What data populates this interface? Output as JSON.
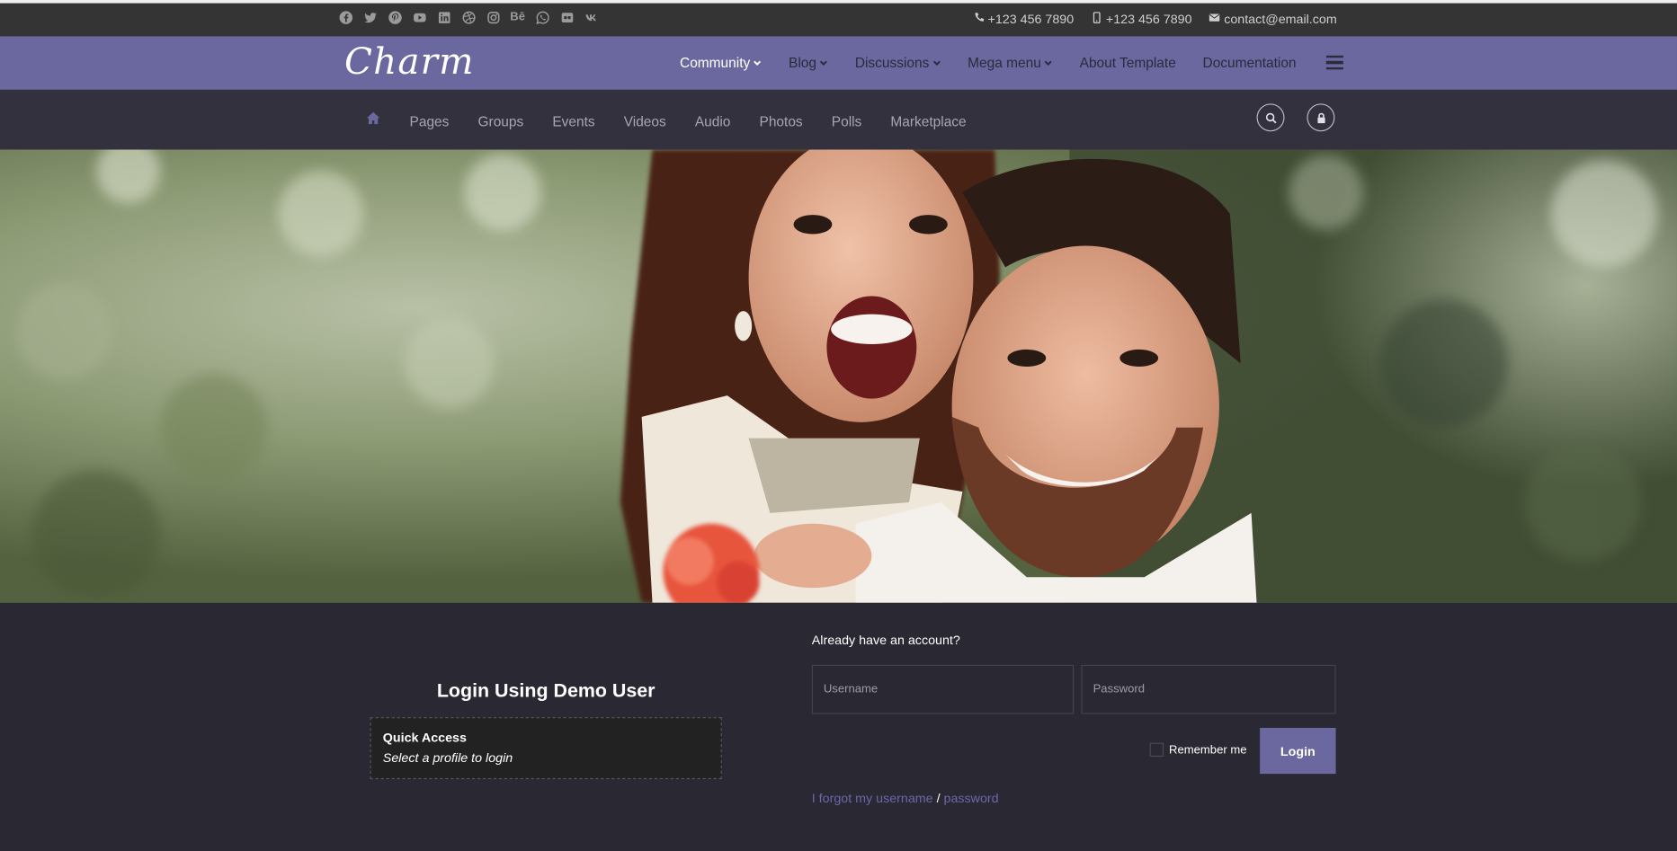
{
  "topbar": {
    "social_icons": [
      "facebook-icon",
      "twitter-icon",
      "pinterest-icon",
      "youtube-icon",
      "linkedin-icon",
      "dribbble-icon",
      "instagram-icon",
      "behance-icon",
      "whatsapp-icon",
      "flickr-icon",
      "vk-icon"
    ],
    "behance_text": "Bē",
    "vk_text": "vk",
    "phone1": "+123 456 7890",
    "phone2": "+123 456 7890",
    "email": "contact@email.com"
  },
  "header": {
    "logo": "Charm",
    "nav": [
      {
        "label": "Community",
        "dropdown": true
      },
      {
        "label": "Blog",
        "dropdown": true
      },
      {
        "label": "Discussions",
        "dropdown": true
      },
      {
        "label": "Mega menu",
        "dropdown": true
      },
      {
        "label": "About Template",
        "dropdown": false
      },
      {
        "label": "Documentation",
        "dropdown": false
      }
    ]
  },
  "subnav": {
    "items": [
      "Pages",
      "Groups",
      "Events",
      "Videos",
      "Audio",
      "Photos",
      "Polls",
      "Marketplace"
    ]
  },
  "login": {
    "demo_title": "Login Using Demo User",
    "quick_title": "Quick Access",
    "quick_sub": "Select a profile to login",
    "account_prompt": "Already have an account?",
    "username_placeholder": "Username",
    "password_placeholder": "Password",
    "remember_label": "Remember me",
    "login_label": "Login",
    "forgot_username": "I forgot my username",
    "forgot_sep": " / ",
    "forgot_password": "password"
  },
  "colors": {
    "accent": "#6a689e",
    "topbar_bg": "#343434",
    "subnav_bg": "#33313e",
    "page_bg": "#2a2833"
  }
}
